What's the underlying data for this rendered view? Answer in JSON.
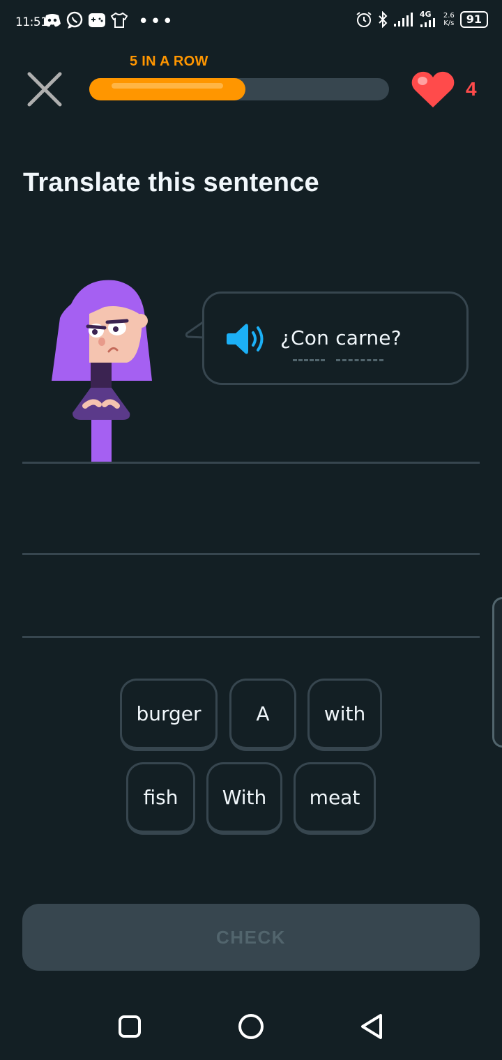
{
  "status_bar": {
    "time": "11:51",
    "left_icons": [
      "discord-icon",
      "whatsapp-icon",
      "game-icon",
      "shirt-icon"
    ],
    "more": "•••",
    "network": "4G",
    "speed_value": "2.6",
    "speed_unit": "K/s",
    "battery": "91"
  },
  "header": {
    "streak_label": "5 IN A ROW",
    "progress": 0.52,
    "hearts": "4",
    "colors": {
      "streak": "#ff9600",
      "progress_fill": "#ff9600",
      "heart": "#ff4b4b"
    }
  },
  "challenge": {
    "title": "Translate this sentence",
    "prompt": "¿Con carne?"
  },
  "word_bank": {
    "row1": [
      "burger",
      "A",
      "with"
    ],
    "row2": [
      "fish",
      "With",
      "meat"
    ]
  },
  "check_button": {
    "label": "CHECK"
  }
}
